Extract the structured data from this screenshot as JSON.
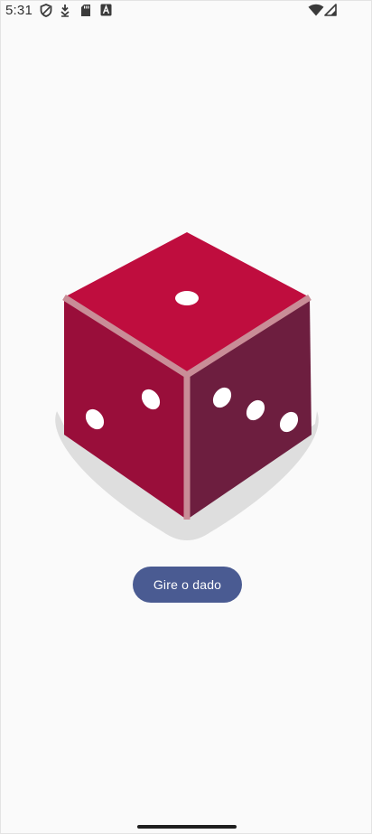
{
  "status_bar": {
    "time": "5:31",
    "left_icons": [
      "shield-icon",
      "download-icon",
      "sd-card-icon",
      "keyboard-a-icon"
    ],
    "right_icons": [
      "wifi-icon",
      "cellular-signal-icon"
    ]
  },
  "dice": {
    "top_face_pips": 1,
    "left_face_pips": 2,
    "right_face_pips": 3,
    "colors": {
      "top": "#bf0d3e",
      "left": "#990e3a",
      "right": "#6d1e3f",
      "edge": "#c98d97",
      "shadow": "#dedede"
    }
  },
  "button": {
    "label": "Gire o dado",
    "color": "#4a5b92"
  }
}
